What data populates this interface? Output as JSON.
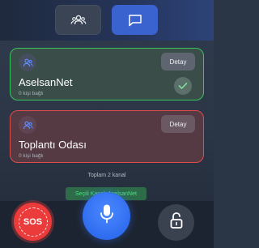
{
  "tabs": [
    {
      "name": "users",
      "icon": "users-icon",
      "active": true
    },
    {
      "name": "chat",
      "icon": "chat-icon",
      "active": false
    }
  ],
  "channels": [
    {
      "name": "AselsanNet",
      "subtitle": "0 kişi bağlı",
      "detail_label": "Detay",
      "status_color": "#3ac45f",
      "selected": true
    },
    {
      "name": "Toplantı Odası",
      "subtitle": "0 kişi bağlı",
      "detail_label": "Detay",
      "status_color": "#e04a4a",
      "selected": false
    }
  ],
  "summary": {
    "total_label": "Toplam 2 kanal",
    "selected_label": "Seçili Kanal: AselsanNet"
  },
  "bottom": {
    "sos_label": "SOS",
    "sos_color": "#ec3b3b",
    "mic_color": "#2f6df0",
    "mic_icon": "microphone-icon",
    "lock_icon": "unlock-icon"
  }
}
